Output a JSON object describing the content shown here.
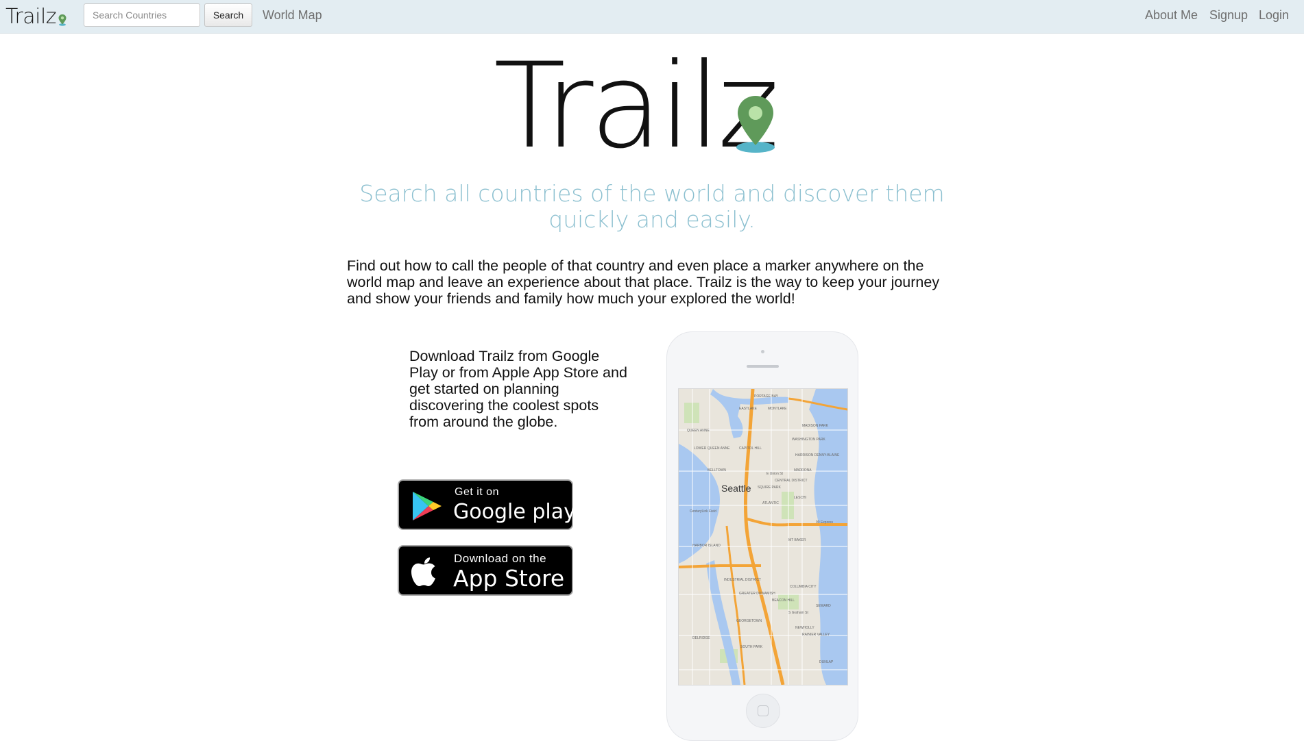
{
  "navbar": {
    "brand": "Trailz",
    "search_placeholder": "Search Countries",
    "search_button": "Search",
    "world_map": "World Map",
    "about_me": "About Me",
    "signup": "Signup",
    "login": "Login"
  },
  "hero": {
    "logo_text": "Trailz",
    "tagline": "Search all countries of the world and discover them quickly and easily.",
    "intro": "Find out how to call the people of that country and even place a marker anywhere on the world map and leave an experience about that place. Trailz is the way to keep your journey and show your friends and family how much your explored the world!"
  },
  "download": {
    "text": "Download Trailz from Google Play or from Apple App Store and get started on planning discovering the coolest spots from around the globe.",
    "google_small": "Get it on",
    "google_big": "Google play",
    "apple_small": "Download on the",
    "apple_big": "App Store"
  },
  "phone_map": {
    "city": "Seattle",
    "labels": [
      "PORTAGE BAY",
      "EASTLAKE",
      "MONTLAKE",
      "MADISON PARK",
      "QUEEN ANNE",
      "WASHINGTON PARK",
      "LOWER QUEEN ANNE",
      "CAPITOL HILL",
      "HARRISON DENNY-BLAINE",
      "BELLTOWN",
      "E Union St",
      "MADRONA",
      "CENTRAL DISTRICT",
      "SQUIRE PARK",
      "LESCHI",
      "ATLANTIC",
      "CenturyLink Field",
      "90 Express",
      "MT BAKER",
      "HARBOR ISLAND",
      "INDUSTRIAL DISTRICT",
      "GREATER DUWAMISH",
      "COLUMBIA CITY",
      "BEACON HILL",
      "SEWARD",
      "S Graham St",
      "GEORGETOWN",
      "NEWHOLLY",
      "RAINIER VALLEY",
      "DELRIDGE",
      "SOUTH PARK",
      "DUNLAP"
    ]
  },
  "colors": {
    "navbar_bg": "#e3edf2",
    "tagline": "#8cc0d0",
    "pin_green": "#5f9a5a",
    "pin_base": "#56b4c8",
    "water": "#a9c8f0",
    "highway": "#f3a437"
  }
}
